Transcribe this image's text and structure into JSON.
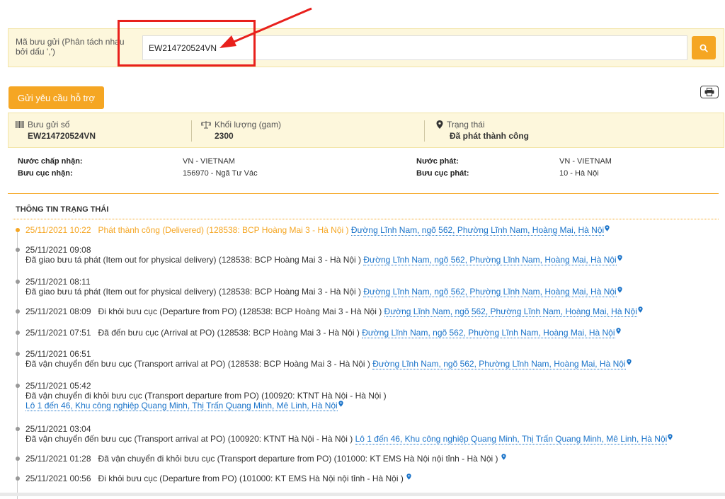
{
  "search": {
    "label": "Mã bưu gửi (Phân tách nhau bởi dấu ',')",
    "value": "EW214720524VN"
  },
  "buttons": {
    "support": "Gửi yêu cầu hỗ trợ"
  },
  "header": {
    "item_label": "Bưu gửi số",
    "item_value": "EW214720524VN",
    "weight_label": "Khối lượng (gam)",
    "weight_value": "2300",
    "status_label": "Trạng thái",
    "status_value": "Đã phát thành công"
  },
  "details": {
    "accept_country_label": "Nước chấp nhận:",
    "accept_country_value": "VN - VIETNAM",
    "accept_office_label": "Bưu cục nhận:",
    "accept_office_value": "156970 - Ngã Tư Vác",
    "deliver_country_label": "Nước phát:",
    "deliver_country_value": "VN - VIETNAM",
    "deliver_office_label": "Bưu cục phát:",
    "deliver_office_value": "10 - Hà Nội"
  },
  "status_section_title": "THÔNG TIN TRẠNG THÁI",
  "timeline": [
    {
      "time": "25/11/2021 10:22",
      "text": "Phát thành công (Delivered) (128538: BCP Hoàng Mai 3 - Hà Nội )",
      "location": "Đường Lĩnh Nam, ngõ 562, Phường Lĩnh Nam, Hoàng Mai, Hà Nội",
      "layout": "inline",
      "active": true
    },
    {
      "time": "25/11/2021 09:08",
      "text": "Đã giao bưu tá phát (Item out for physical delivery) (128538: BCP Hoàng Mai 3 - Hà Nội )",
      "location": "Đường Lĩnh Nam, ngõ 562, Phường Lĩnh Nam, Hoàng Mai, Hà Nội",
      "layout": "two-line"
    },
    {
      "time": "25/11/2021 08:11",
      "text": "Đã giao bưu tá phát (Item out for physical delivery) (128538: BCP Hoàng Mai 3 - Hà Nội )",
      "location": "Đường Lĩnh Nam, ngõ 562, Phường Lĩnh Nam, Hoàng Mai, Hà Nội",
      "layout": "two-line"
    },
    {
      "time": "25/11/2021 08:09",
      "text": "Đi khỏi bưu cục (Departure from PO) (128538: BCP Hoàng Mai 3 - Hà Nội )",
      "location": "Đường Lĩnh Nam, ngõ 562, Phường Lĩnh Nam, Hoàng Mai, Hà Nội",
      "layout": "inline"
    },
    {
      "time": "25/11/2021 07:51",
      "text": "Đã đến bưu cục (Arrival at PO) (128538: BCP Hoàng Mai 3 - Hà Nội )",
      "location": "Đường Lĩnh Nam, ngõ 562, Phường Lĩnh Nam, Hoàng Mai, Hà Nội",
      "layout": "inline"
    },
    {
      "time": "25/11/2021 06:51",
      "text": "Đã vận chuyển đến bưu cục (Transport arrival at PO) (128538: BCP Hoàng Mai 3 - Hà Nội )",
      "location": "Đường Lĩnh Nam, ngõ 562, Phường Lĩnh Nam, Hoàng Mai, Hà Nội",
      "layout": "two-line"
    },
    {
      "time": "25/11/2021 05:42",
      "text": "Đã vận chuyển đi khỏi bưu cục (Transport departure from PO) (100920: KTNT Hà Nội - Hà Nội )",
      "location": "Lô 1 đến 46, Khu công nghiệp Quang Minh, Thị Trấn Quang Minh, Mê Linh, Hà Nội",
      "layout": "three-line"
    },
    {
      "time": "25/11/2021 03:04",
      "text": "Đã vận chuyển đến bưu cục (Transport arrival at PO) (100920: KTNT Hà Nội - Hà Nội )",
      "location": "Lô 1 đến 46, Khu công nghiệp Quang Minh, Thị Trấn Quang Minh, Mê Linh, Hà Nội",
      "layout": "two-line"
    },
    {
      "time": "25/11/2021 01:28",
      "text": "Đã vận chuyển đi khỏi bưu cục (Transport departure from PO) (101000: KT EMS Hà Nội nội tỉnh - Hà Nội )",
      "location": "",
      "layout": "inline"
    },
    {
      "time": "25/11/2021 00:56",
      "text": "Đi khỏi bưu cục (Departure from PO) (101000: KT EMS Hà Nội nội tỉnh - Hà Nội )",
      "location": "",
      "layout": "inline"
    }
  ],
  "colors": {
    "accent": "#f5a623",
    "link": "#1a73c9",
    "annotation": "#e8201c",
    "panel_bg": "#fdf7dc"
  }
}
